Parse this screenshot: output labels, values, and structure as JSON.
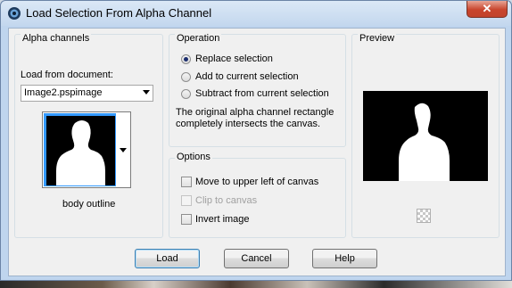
{
  "window": {
    "title": "Load Selection From Alpha Channel",
    "close_glyph": "✕"
  },
  "alpha_channels": {
    "group_label": "Alpha channels",
    "load_from_label": "Load from document:",
    "document_value": "Image2.pspimage",
    "channel_name": "body outline"
  },
  "operation": {
    "group_label": "Operation",
    "options": [
      {
        "label": "Replace selection",
        "selected": true
      },
      {
        "label": "Add to current selection",
        "selected": false
      },
      {
        "label": "Subtract from current selection",
        "selected": false
      }
    ],
    "info_line1": "The original alpha channel rectangle",
    "info_line2": "completely intersects the canvas."
  },
  "options": {
    "group_label": "Options",
    "items": [
      {
        "label": "Move to upper left of canvas",
        "checked": false,
        "enabled": true
      },
      {
        "label": "Clip to canvas",
        "checked": false,
        "enabled": false
      },
      {
        "label": "Invert image",
        "checked": false,
        "enabled": true
      }
    ]
  },
  "preview": {
    "group_label": "Preview",
    "transparency_icon": "checkerboard-icon"
  },
  "buttons": {
    "load": "Load",
    "cancel": "Cancel",
    "help": "Help"
  },
  "colors": {
    "title_bar": "#c3d7ee",
    "close_button": "#c8452d",
    "selection_highlight": "#3399ff"
  }
}
